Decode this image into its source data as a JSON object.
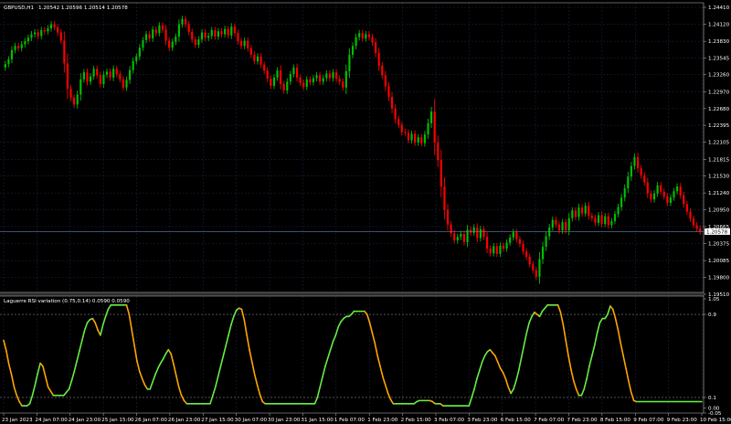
{
  "window": {
    "symbol_title": "GBPUSD,H1",
    "ohlc": "1.20542 1.20596 1.20514 1.20578"
  },
  "price_axis": {
    "labels": [
      "1.24410",
      "1.24120",
      "1.23830",
      "1.23545",
      "1.23260",
      "1.22970",
      "1.22680",
      "1.22395",
      "1.22105",
      "1.21815",
      "1.21530",
      "1.21240",
      "1.20950",
      "1.20665",
      "1.20375",
      "1.20085",
      "1.19800",
      "1.19510"
    ],
    "current_price": "1.20578"
  },
  "indicator": {
    "title": "Laguerre RSI variation (0.75,0.14) 0.0590 0.0590",
    "labels": [
      "1.05",
      "0.9",
      "0.1",
      "0.00",
      "-0.05"
    ]
  },
  "time_axis": {
    "labels": [
      "23 Jan 2023",
      "24 Jan 07:00",
      "24 Jan 23:00",
      "25 Jan 15:00",
      "26 Jan 07:00",
      "26 Jan 23:00",
      "27 Jan 15:00",
      "30 Jan 07:00",
      "30 Jan 23:00",
      "31 Jan 15:00",
      "1 Feb 07:00",
      "1 Feb 23:00",
      "2 Feb 15:00",
      "3 Feb 07:00",
      "3 Feb 23:00",
      "6 Feb 15:00",
      "7 Feb 07:00",
      "7 Feb 23:00",
      "8 Feb 15:00",
      "9 Feb 07:00",
      "9 Feb 23:00",
      "10 Feb 15:00"
    ]
  },
  "colors": {
    "background": "#000000",
    "bull": "#00c000",
    "bear": "#ff0000",
    "grid": "#1e2a4a",
    "axis": "#c0c0c0",
    "rsi_up": "#66ee44",
    "rsi_down": "#ffa500",
    "level_line": "#808080",
    "price_line": "#6a7fb0"
  },
  "chart_data": [
    {
      "type": "candlestick",
      "title": "GBPUSD,H1",
      "ylim": [
        1.1951,
        1.2441
      ],
      "series": [
        {
          "name": "GBPUSD",
          "close": [
            1.2344,
            1.2352,
            1.2368,
            1.2375,
            1.2371,
            1.2378,
            1.2383,
            1.2389,
            1.2395,
            1.2398,
            1.2392,
            1.2402,
            1.24,
            1.2405,
            1.2412,
            1.2407,
            1.2398,
            1.2384,
            1.2345,
            1.2302,
            1.2287,
            1.2275,
            1.2292,
            1.2318,
            1.233,
            1.2314,
            1.2323,
            1.2336,
            1.2325,
            1.231,
            1.2326,
            1.2331,
            1.2321,
            1.2336,
            1.2327,
            1.2318,
            1.2304,
            1.2317,
            1.2334,
            1.2349,
            1.2357,
            1.2372,
            1.2385,
            1.2395,
            1.2388,
            1.2403,
            1.2397,
            1.241,
            1.2403,
            1.2384,
            1.2372,
            1.2382,
            1.2391,
            1.2412,
            1.2421,
            1.2412,
            1.2399,
            1.2386,
            1.2377,
            1.2386,
            1.2398,
            1.2389,
            1.2392,
            1.2402,
            1.2391,
            1.24,
            1.2395,
            1.2404,
            1.2393,
            1.2408,
            1.2397,
            1.2383,
            1.2375,
            1.2384,
            1.2371,
            1.236,
            1.2349,
            1.2357,
            1.2343,
            1.2333,
            1.2319,
            1.2307,
            1.2321,
            1.2333,
            1.231,
            1.2299,
            1.2314,
            1.2327,
            1.2338,
            1.2321,
            1.2312,
            1.2305,
            1.2318,
            1.2313,
            1.232,
            1.2325,
            1.2314,
            1.232,
            1.2328,
            1.232,
            1.233,
            1.2319,
            1.2314,
            1.2304,
            1.2332,
            1.236,
            1.2375,
            1.239,
            1.2397,
            1.2388,
            1.2395,
            1.239,
            1.2381,
            1.2363,
            1.2341,
            1.2325,
            1.2306,
            1.2288,
            1.2268,
            1.225,
            1.224,
            1.2228,
            1.2227,
            1.2214,
            1.2225,
            1.221,
            1.2219,
            1.2209,
            1.2224,
            1.2243,
            1.2263,
            1.221,
            1.218,
            1.2135,
            1.2095,
            1.207,
            1.2055,
            1.2043,
            1.2049,
            1.2054,
            1.204,
            1.2061,
            1.2056,
            1.2065,
            1.2047,
            1.2062,
            1.2049,
            1.2029,
            1.2021,
            1.2033,
            1.202,
            1.2034,
            1.2029,
            1.2039,
            1.2048,
            1.2057,
            1.2045,
            1.2037,
            1.2024,
            1.2015,
            1.2002,
            1.1992,
            1.1981,
            1.2011,
            1.2032,
            1.205,
            1.2065,
            1.2078,
            1.207,
            1.206,
            1.2074,
            1.206,
            1.2081,
            1.2094,
            1.2083,
            1.2099,
            1.2089,
            1.2102,
            1.2085,
            1.2081,
            1.2073,
            1.2086,
            1.2071,
            1.2084,
            1.2069,
            1.2076,
            1.2088,
            1.21,
            1.2116,
            1.2132,
            1.2152,
            1.217,
            1.2185,
            1.2166,
            1.2154,
            1.2142,
            1.2123,
            1.2113,
            1.2123,
            1.2137,
            1.2126,
            1.2118,
            1.2107,
            1.2116,
            1.2127,
            1.2135,
            1.212,
            1.2105,
            1.2092,
            1.208,
            1.2069,
            1.2063,
            1.2058
          ]
        }
      ]
    },
    {
      "type": "line",
      "title": "Laguerre RSI variation (0.75,0.14) 0.0590 0.0590",
      "ylim": [
        -0.05,
        1.05
      ],
      "levels": [
        0.9,
        0.1
      ],
      "series": [
        {
          "name": "Laguerre RSI",
          "values": [
            0.65,
            0.55,
            0.42,
            0.32,
            0.2,
            0.12,
            0.06,
            0.02,
            0.02,
            0.02,
            0.04,
            0.12,
            0.22,
            0.33,
            0.43,
            0.4,
            0.3,
            0.2,
            0.16,
            0.12,
            0.12,
            0.12,
            0.12,
            0.12,
            0.15,
            0.18,
            0.26,
            0.35,
            0.45,
            0.55,
            0.65,
            0.75,
            0.82,
            0.85,
            0.86,
            0.82,
            0.75,
            0.7,
            0.8,
            0.88,
            0.95,
            0.99,
            0.99,
            0.99,
            0.99,
            0.99,
            0.99,
            0.99,
            0.9,
            0.75,
            0.6,
            0.45,
            0.35,
            0.28,
            0.22,
            0.18,
            0.18,
            0.25,
            0.32,
            0.38,
            0.43,
            0.47,
            0.52,
            0.56,
            0.52,
            0.42,
            0.31,
            0.2,
            0.12,
            0.07,
            0.04,
            0.04,
            0.04,
            0.04,
            0.04,
            0.04,
            0.04,
            0.04,
            0.04,
            0.04,
            0.12,
            0.2,
            0.3,
            0.4,
            0.5,
            0.6,
            0.7,
            0.8,
            0.88,
            0.94,
            0.96,
            0.95,
            0.85,
            0.7,
            0.56,
            0.44,
            0.32,
            0.22,
            0.13,
            0.06,
            0.04,
            0.04,
            0.04,
            0.04,
            0.04,
            0.04,
            0.04,
            0.04,
            0.04,
            0.04,
            0.04,
            0.04,
            0.04,
            0.04,
            0.04,
            0.04,
            0.04,
            0.04,
            0.04,
            0.04,
            0.1,
            0.2,
            0.3,
            0.4,
            0.48,
            0.56,
            0.64,
            0.7,
            0.78,
            0.83,
            0.86,
            0.88,
            0.88,
            0.9,
            0.93,
            0.93,
            0.93,
            0.93,
            0.93,
            0.9,
            0.82,
            0.72,
            0.62,
            0.5,
            0.4,
            0.3,
            0.22,
            0.14,
            0.08,
            0.04,
            0.04,
            0.04,
            0.04,
            0.04,
            0.04,
            0.04,
            0.04,
            0.04,
            0.06,
            0.07,
            0.07,
            0.07,
            0.07,
            0.07,
            0.06,
            0.04,
            0.04,
            0.04,
            0.02,
            0.02,
            0.02,
            0.02,
            0.02,
            0.02,
            0.02,
            0.02,
            0.02,
            0.02,
            0.02,
            0.1,
            0.18,
            0.28,
            0.36,
            0.44,
            0.5,
            0.54,
            0.56,
            0.53,
            0.5,
            0.44,
            0.38,
            0.34,
            0.28,
            0.2,
            0.14,
            0.18,
            0.26,
            0.36,
            0.48,
            0.6,
            0.72,
            0.82,
            0.88,
            0.92,
            0.9,
            0.88,
            0.93,
            0.96,
            0.99,
            0.99,
            0.99,
            0.99,
            0.99,
            0.92,
            0.8,
            0.65,
            0.5,
            0.37,
            0.26,
            0.18,
            0.12,
            0.12,
            0.18,
            0.28,
            0.4,
            0.5,
            0.6,
            0.72,
            0.82,
            0.86,
            0.86,
            0.9,
            0.98,
            0.95,
            0.86,
            0.75,
            0.62,
            0.5,
            0.38,
            0.26,
            0.15,
            0.07,
            0.06,
            0.06,
            0.06,
            0.06,
            0.06,
            0.06,
            0.06,
            0.06,
            0.06,
            0.06,
            0.06,
            0.06,
            0.06,
            0.06,
            0.06,
            0.06,
            0.06,
            0.06,
            0.06,
            0.06,
            0.06,
            0.06,
            0.06,
            0.06,
            0.06,
            0.06
          ]
        }
      ]
    }
  ]
}
